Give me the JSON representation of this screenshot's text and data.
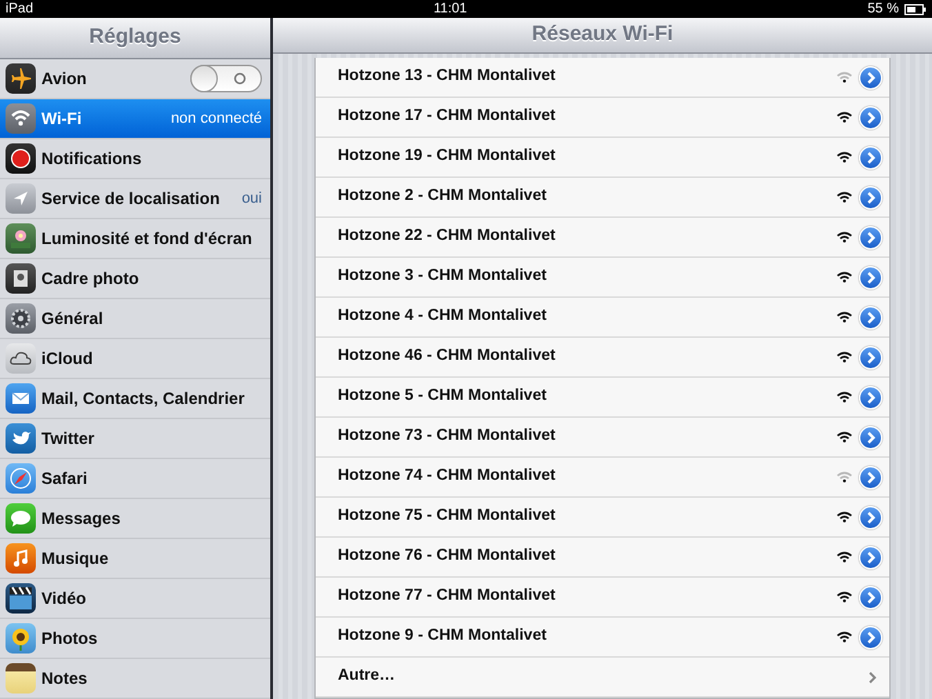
{
  "status_bar": {
    "device": "iPad",
    "time": "11:01",
    "battery": "55 %"
  },
  "sidebar": {
    "title": "Réglages",
    "items": [
      {
        "label": "Avion",
        "kind": "toggle",
        "on": false,
        "selected": false
      },
      {
        "label": "Wi-Fi",
        "kind": "value",
        "value": "non connecté",
        "selected": true
      },
      {
        "label": "Notifications",
        "kind": "plain",
        "selected": false
      },
      {
        "label": "Service de localisation",
        "kind": "value",
        "value": "oui",
        "selected": false
      },
      {
        "label": "Luminosité et fond d'écran",
        "kind": "plain",
        "selected": false
      },
      {
        "label": "Cadre photo",
        "kind": "plain",
        "selected": false
      },
      {
        "label": "Général",
        "kind": "plain",
        "selected": false
      },
      {
        "label": "iCloud",
        "kind": "plain",
        "selected": false
      },
      {
        "label": "Mail, Contacts, Calendrier",
        "kind": "plain",
        "selected": false
      },
      {
        "label": "Twitter",
        "kind": "plain",
        "selected": false
      },
      {
        "label": "Safari",
        "kind": "plain",
        "selected": false
      },
      {
        "label": "Messages",
        "kind": "plain",
        "selected": false
      },
      {
        "label": "Musique",
        "kind": "plain",
        "selected": false
      },
      {
        "label": "Vidéo",
        "kind": "plain",
        "selected": false
      },
      {
        "label": "Photos",
        "kind": "plain",
        "selected": false
      },
      {
        "label": "Notes",
        "kind": "plain",
        "selected": false
      }
    ]
  },
  "detail": {
    "title": "Réseaux Wi-Fi",
    "networks": [
      {
        "name": "Hotzone 13 - CHM Montalivet",
        "weak": true
      },
      {
        "name": "Hotzone 17 - CHM Montalivet",
        "weak": false
      },
      {
        "name": "Hotzone 19 - CHM Montalivet",
        "weak": false
      },
      {
        "name": "Hotzone 2 - CHM Montalivet",
        "weak": false
      },
      {
        "name": "Hotzone 22 - CHM Montalivet",
        "weak": false
      },
      {
        "name": "Hotzone 3 - CHM Montalivet",
        "weak": false
      },
      {
        "name": "Hotzone 4 - CHM Montalivet",
        "weak": false
      },
      {
        "name": "Hotzone 46 - CHM Montalivet",
        "weak": false
      },
      {
        "name": "Hotzone 5 - CHM Montalivet",
        "weak": false
      },
      {
        "name": "Hotzone 73 - CHM Montalivet",
        "weak": false
      },
      {
        "name": "Hotzone 74 - CHM Montalivet",
        "weak": true
      },
      {
        "name": "Hotzone 75 - CHM Montalivet",
        "weak": false
      },
      {
        "name": "Hotzone 76 - CHM Montalivet",
        "weak": false
      },
      {
        "name": "Hotzone 77 - CHM Montalivet",
        "weak": false
      },
      {
        "name": "Hotzone 9 - CHM Montalivet",
        "weak": false
      }
    ],
    "other": "Autre…"
  }
}
